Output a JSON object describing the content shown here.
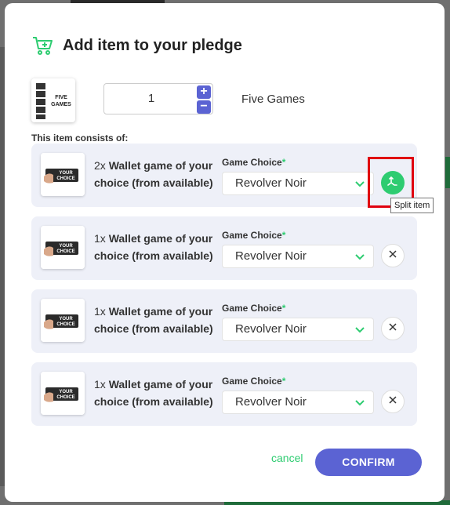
{
  "modal": {
    "title": "Add item to your pledge"
  },
  "product": {
    "thumb_caption": "FIVE GAMES",
    "quantity": "1",
    "plus": "+",
    "minus": "−",
    "name": "Five Games"
  },
  "consists_label": "This item consists of:",
  "items": [
    {
      "qty": "2x",
      "name": "Wallet game of your choice (from available)",
      "thumb_text": "YOUR CHOICE",
      "field_label": "Game Choice",
      "required": "*",
      "selected": "Revolver Noir",
      "action": "split"
    },
    {
      "qty": "1x",
      "name": "Wallet game of your choice (from available)",
      "thumb_text": "YOUR CHOICE",
      "field_label": "Game Choice",
      "required": "*",
      "selected": "Revolver Noir",
      "action": "remove"
    },
    {
      "qty": "1x",
      "name": "Wallet game of your choice (from available)",
      "thumb_text": "YOUR CHOICE",
      "field_label": "Game Choice",
      "required": "*",
      "selected": "Revolver Noir",
      "action": "remove"
    },
    {
      "qty": "1x",
      "name": "Wallet game of your choice (from available)",
      "thumb_text": "YOUR CHOICE",
      "field_label": "Game Choice",
      "required": "*",
      "selected": "Revolver Noir",
      "action": "remove"
    }
  ],
  "tooltip": "Split item",
  "footer": {
    "cancel": "cancel",
    "confirm": "CONFIRM"
  },
  "colors": {
    "accent_green": "#2ecc71",
    "primary": "#5b63d3",
    "card_bg": "#eef0f8",
    "highlight": "#e0000f"
  },
  "icons": {
    "header": "cart-plus-icon",
    "split": "split-icon",
    "remove": "close-icon",
    "select": "chevron-down-icon"
  }
}
